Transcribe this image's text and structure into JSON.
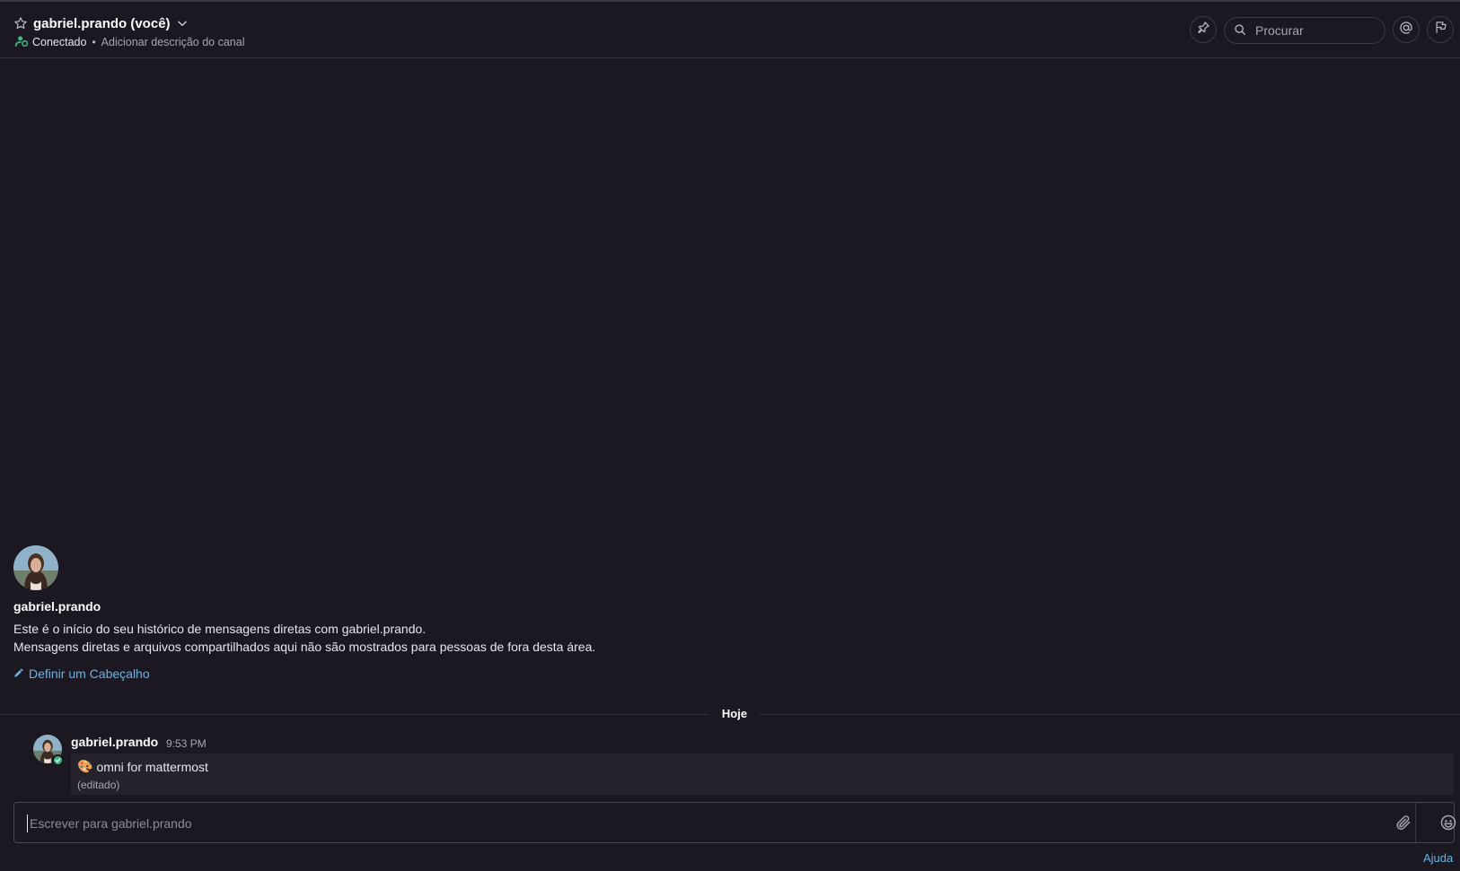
{
  "header": {
    "channel_name": "gabriel.prando (você)",
    "status": "Conectado",
    "separator": "•",
    "add_description": "Adicionar descrição do canal",
    "search_placeholder": "Procurar",
    "icons": {
      "favorite": "star-outline-icon",
      "dropdown": "chevron-down-icon",
      "status": "online-people-icon",
      "pinned": "pin-icon",
      "search": "search-icon",
      "mentions": "at-icon",
      "flagged": "flag-icon"
    }
  },
  "intro": {
    "username": "gabriel.prando",
    "line1": "Este é o início do seu histórico de mensagens diretas com gabriel.prando.",
    "line2": "Mensagens diretas e arquivos compartilhados aqui não são mostrados para pessoas de fora desta área.",
    "set_header_label": "Definir um Cabeçalho"
  },
  "date_separator": "Hoje",
  "posts": [
    {
      "author": "gabriel.prando",
      "time": "9:53 PM",
      "emoji": "🎨",
      "text": "omni for mattermost",
      "edited_label": "(editado)"
    }
  ],
  "composer": {
    "placeholder": "Escrever para gabriel.prando",
    "help_label": "Ajuda"
  },
  "colors": {
    "background": "#1b1822",
    "post_background": "#25222c",
    "link": "#67b5e6",
    "online": "#3db887"
  }
}
